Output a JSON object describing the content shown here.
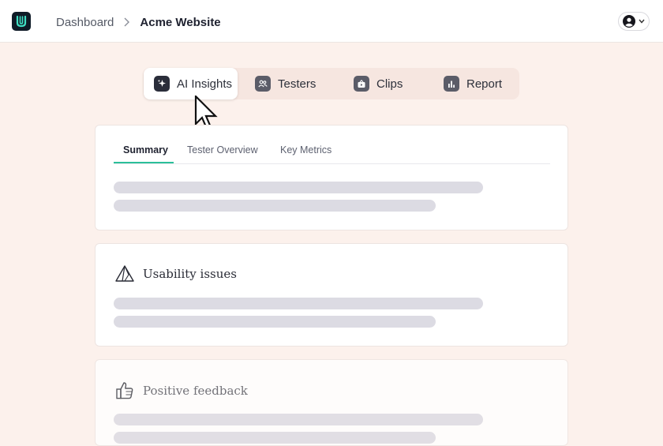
{
  "header": {
    "logo_icon": "uxcam-logo-icon",
    "breadcrumb": {
      "parent": "Dashboard",
      "current": "Acme Website"
    },
    "account_icon": "user-circle-icon"
  },
  "segments": [
    {
      "label": "AI Insights",
      "icon": "sparkle-icon",
      "active": true
    },
    {
      "label": "Testers",
      "icon": "users-icon",
      "active": false
    },
    {
      "label": "Clips",
      "icon": "video-clip-icon",
      "active": false
    },
    {
      "label": "Report",
      "icon": "bar-chart-icon",
      "active": false
    }
  ],
  "summary_card": {
    "tabs": [
      {
        "label": "Summary",
        "active": true
      },
      {
        "label": "Tester Overview",
        "active": false
      },
      {
        "label": "Key Metrics",
        "active": false
      }
    ]
  },
  "usability_card": {
    "icon": "warning-triangle-icon",
    "title": "Usability issues"
  },
  "positive_card": {
    "icon": "thumbs-up-icon",
    "title": "Positive feedback"
  },
  "colors": {
    "page_background": "#fcf1ec",
    "accent_underline": "#2bbf9a",
    "skeleton": "#dcdbe3",
    "icon_tile": "#5b5c68"
  }
}
